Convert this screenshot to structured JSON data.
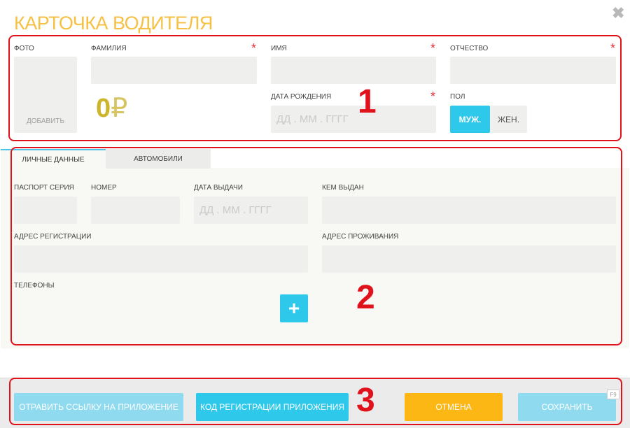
{
  "window": {
    "title": "КАРТОЧКА ВОДИТЕЛЯ",
    "close_glyph": "✖"
  },
  "section1": {
    "photo_label": "ФОТО",
    "photo_add": "ДОБАВИТЬ",
    "surname_label": "ФАМИЛИЯ",
    "name_label": "ИМЯ",
    "patronymic_label": "ОТЧЕСТВО",
    "birthdate_label": "ДАТА РОЖДЕНИЯ",
    "birthdate_placeholder": "ДД . ММ . ГГГГ",
    "gender_label": "ПОЛ",
    "gender_male": "МУЖ.",
    "gender_female": "ЖЕН.",
    "balance": "0",
    "currency": "₽",
    "required_mark": "*",
    "annotation": "1"
  },
  "tabs": [
    {
      "label": "ЛИЧНЫЕ ДАННЫЕ",
      "active": true
    },
    {
      "label": "АВТОМОБИЛИ",
      "active": false
    }
  ],
  "section2": {
    "passport_series_label": "ПАСПОРТ СЕРИЯ",
    "number_label": "НОМЕР",
    "issue_date_label": "ДАТА ВЫДАЧИ",
    "issue_date_placeholder": "ДД . ММ . ГГГГ",
    "issued_by_label": "КЕМ ВЫДАН",
    "reg_address_label": "АДРЕС РЕГИСТРАЦИИ",
    "live_address_label": "АДРЕС ПРОЖИВАНИЯ",
    "phones_label": "ТЕЛЕФОНЫ",
    "add_phone_glyph": "+",
    "annotation": "2"
  },
  "footer": {
    "send_link": "ОТРАВИТЬ ССЫЛКУ НА ПРИЛОЖЕНИЕ",
    "reg_code": "КОД РЕГИСТРАЦИИ ПРИЛОЖЕНИЯ",
    "cancel": "ОТМЕНА",
    "save": "СОХРАНИТЬ",
    "save_hotkey": "F9",
    "annotation": "3"
  },
  "colors": {
    "title": "#f5c044",
    "accent": "#2dc8ea",
    "accent_light": "#8fdaef",
    "cancel": "#fdb715",
    "required": "#e8323c",
    "annotation_red": "#e0121c"
  },
  "icons": {
    "close": "close-icon",
    "plus": "plus-icon",
    "currency": "ruble-icon"
  }
}
